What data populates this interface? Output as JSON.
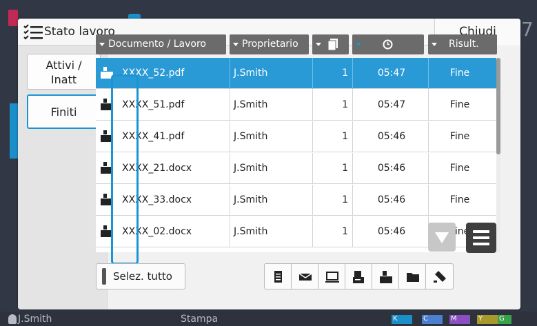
{
  "background": {
    "user": "J.Smith",
    "app": "Stampa",
    "ink": [
      "K",
      "C",
      "M",
      "Y",
      "G"
    ],
    "right_number": "7"
  },
  "dialog": {
    "title": "Stato lavoro",
    "close_label": "Chiudi"
  },
  "tabs": [
    {
      "label": "Attivi /\nInatt",
      "line1": "Attivi /",
      "line2": "Inatt"
    },
    {
      "label": "Finiti"
    }
  ],
  "columns": {
    "document": "Documento / Lavoro",
    "owner": "Proprietario",
    "result": "Risult."
  },
  "rows": [
    {
      "name": "XXXX_52.pdf",
      "owner": "J.Smith",
      "copies": "1",
      "time": "05:47",
      "result": "Fine",
      "selected": true
    },
    {
      "name": "XXXX_51.pdf",
      "owner": "J.Smith",
      "copies": "1",
      "time": "05:47",
      "result": "Fine"
    },
    {
      "name": "XXXX_41.pdf",
      "owner": "J.Smith",
      "copies": "1",
      "time": "05:46",
      "result": "Fine"
    },
    {
      "name": "XXXX_21.docx",
      "owner": "J.Smith",
      "copies": "1",
      "time": "05:46",
      "result": "Fine"
    },
    {
      "name": "XXXX_33.docx",
      "owner": "J.Smith",
      "copies": "1",
      "time": "05:46",
      "result": "Fine"
    },
    {
      "name": "XXXX_02.docx",
      "owner": "J.Smith",
      "copies": "1",
      "time": "05:46",
      "result": "Fine"
    }
  ],
  "toolbar": {
    "select_all": "Selez. tutto",
    "tools": [
      "copy-icon",
      "mail-icon",
      "pc-icon",
      "fax-icon",
      "print-icon",
      "folder-icon",
      "storage-icon"
    ]
  },
  "colors": {
    "accent": "#1a95d3",
    "selected_row": "#2a9ad6",
    "header": "#6b6b6b"
  }
}
